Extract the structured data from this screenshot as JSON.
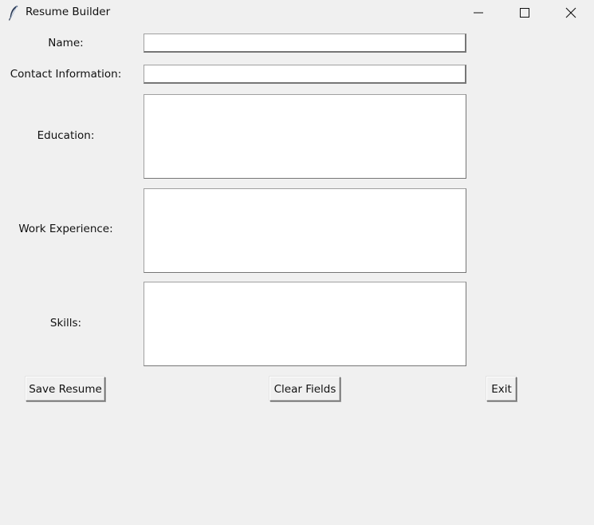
{
  "window": {
    "title": "Resume Builder",
    "app_icon": "feather-icon",
    "controls": {
      "minimize": "minimize-icon",
      "maximize": "maximize-icon",
      "close": "close-icon"
    }
  },
  "form": {
    "name": {
      "label": "Name:",
      "value": ""
    },
    "contact": {
      "label": "Contact Information:",
      "value": ""
    },
    "education": {
      "label": "Education:",
      "value": ""
    },
    "work": {
      "label": "Work Experience:",
      "value": ""
    },
    "skills": {
      "label": "Skills:",
      "value": ""
    }
  },
  "buttons": {
    "save": "Save Resume",
    "clear": "Clear Fields",
    "exit": "Exit"
  }
}
